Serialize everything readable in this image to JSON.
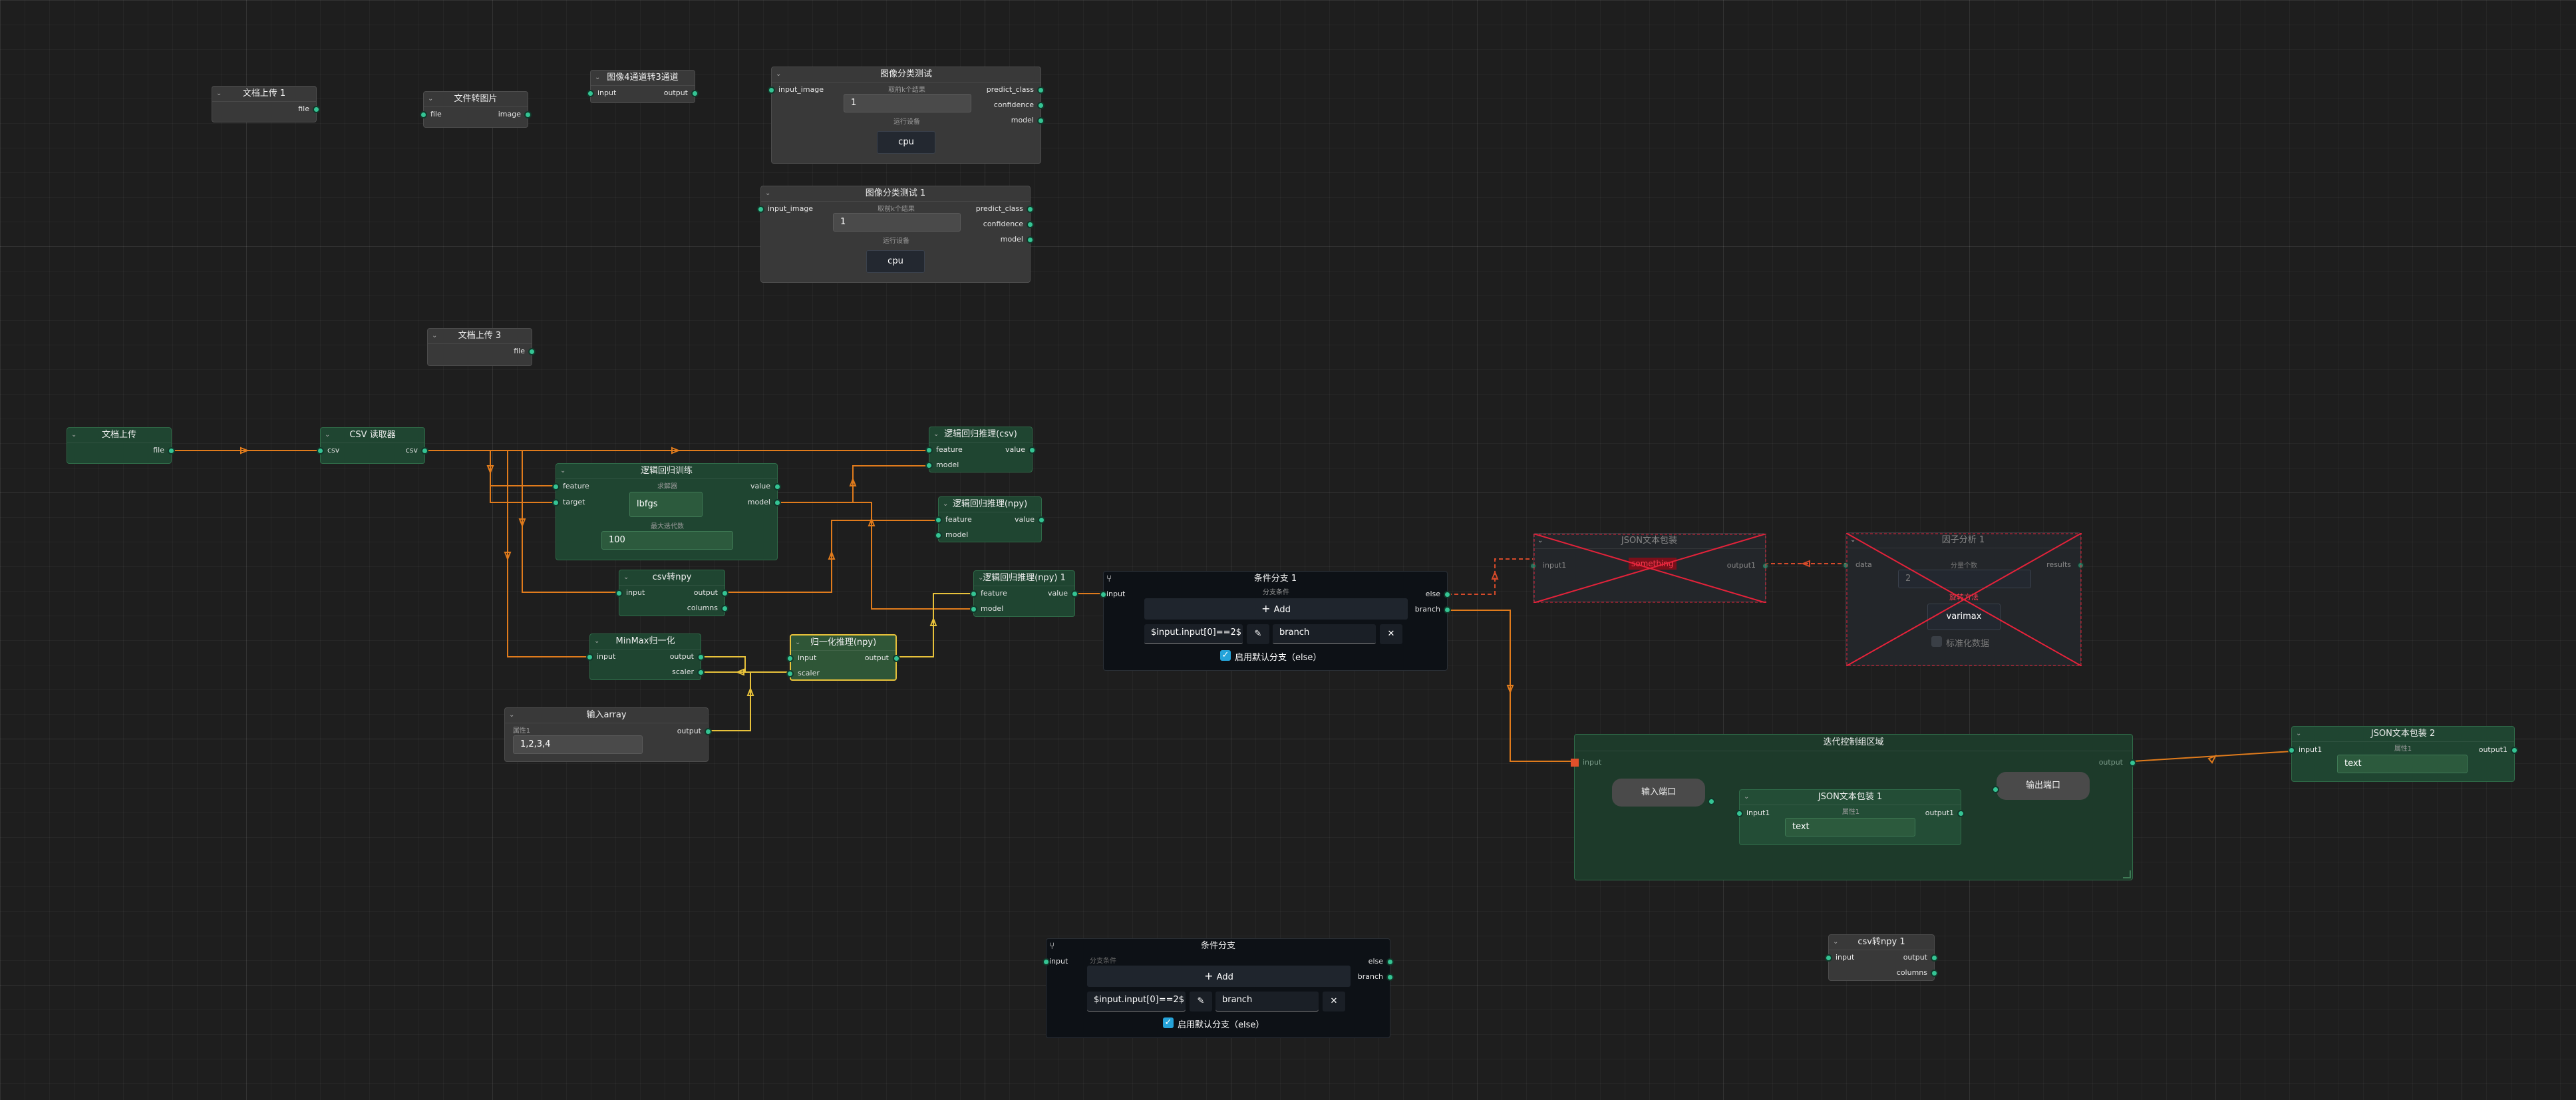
{
  "colors": {
    "canvas": "#1e1e1e",
    "port": "#35c494",
    "edge": "#e07b1c",
    "edge_yellow": "#e8c23b",
    "error": "#e6223a",
    "checkbox": "#25a3d9"
  },
  "icons": {
    "collapse": "chevron-down-icon",
    "branch": "branch-icon",
    "edit": "pencil-icon",
    "close": "x-icon",
    "check": "check-icon",
    "add": "plus-icon"
  },
  "nodes": {
    "upload1": {
      "title": "文档上传 1",
      "out": "file"
    },
    "readimg": {
      "title": "文件转图片",
      "in": "file",
      "out": "image"
    },
    "rgb": {
      "title": "图像4通道转3通道",
      "in": "input",
      "out": "output"
    },
    "cls": {
      "title": "图像分类测试",
      "in": "input_image",
      "out1": "predict_class",
      "out2": "confidence",
      "out3": "model",
      "label1": "取前k个结果",
      "value1": "1",
      "label2": "运行设备",
      "value2": "cpu"
    },
    "cls1": {
      "title": "图像分类测试 1",
      "in": "input_image",
      "out1": "predict_class",
      "out2": "confidence",
      "out3": "model",
      "label1": "取前k个结果",
      "value1": "1",
      "label2": "运行设备",
      "value2": "cpu"
    },
    "upload3": {
      "title": "文档上传 3",
      "out": "file"
    },
    "upload": {
      "title": "文档上传",
      "out": "file"
    },
    "csv": {
      "title": "CSV 读取器",
      "in": "csv",
      "out": "csv"
    },
    "lrtrain": {
      "title": "逻辑回归训练",
      "in1": "feature",
      "in2": "target",
      "out1": "value",
      "out2": "model",
      "label1": "求解器",
      "value1": "lbfgs",
      "label2": "最大迭代数",
      "value2": "100"
    },
    "lrcsv": {
      "title": "逻辑回归推理(csv)",
      "in1": "feature",
      "in2": "model",
      "out": "value"
    },
    "lrnpy": {
      "title": "逻辑回归推理(npy)",
      "in1": "feature",
      "in2": "model",
      "out": "value"
    },
    "csv2npy": {
      "title": "csv转npy",
      "in": "input",
      "out1": "output",
      "out2": "columns"
    },
    "lrnpy1": {
      "title": "逻辑回归推理(npy) 1",
      "in1": "feature",
      "in2": "model",
      "out": "value"
    },
    "minmax": {
      "title": "MinMax归一化",
      "in": "input",
      "out1": "output",
      "out2": "scaler"
    },
    "norminf": {
      "title": "归一化推理(npy)",
      "in1": "input",
      "in2": "scaler",
      "out": "output"
    },
    "arr": {
      "title": "输入array",
      "out": "output",
      "label": "属性1",
      "value": "1,2,3,4"
    },
    "cond1": {
      "title": "条件分支 1",
      "in": "input",
      "out1": "else",
      "out2": "branch",
      "sublabel": "分支条件",
      "add": "Add",
      "expr": "$input.input[0]==2$",
      "branch": "branch",
      "check": "启用默认分支（else）"
    },
    "json": {
      "title": "JSON文本包装",
      "in": "input1",
      "out": "output1",
      "err": "something"
    },
    "factor": {
      "title": "因子分析 1",
      "in": "data",
      "out": "results",
      "label1": "分量个数",
      "value1": "2",
      "label2": "旋转方法",
      "value2": "varimax",
      "check": "标准化数据"
    },
    "loop": {
      "title": "迭代控制组区域",
      "in": "input",
      "out": "output",
      "pin": "输入端口",
      "pout": "输出端口"
    },
    "json1": {
      "title": "JSON文本包装 1",
      "in": "input1",
      "out": "output1",
      "label": "属性1",
      "value": "text"
    },
    "json2": {
      "title": "JSON文本包装 2",
      "in": "input1",
      "out": "output1",
      "label": "属性1",
      "value": "text"
    },
    "cond": {
      "title": "条件分支",
      "in": "input",
      "out1": "else",
      "out2": "branch",
      "sublabel": "分支条件",
      "add": "Add",
      "expr": "$input.input[0]==2$",
      "branch": "branch",
      "check": "启用默认分支（else）"
    },
    "csv2npy1": {
      "title": "csv转npy 1",
      "in": "input",
      "out1": "output",
      "out2": "columns"
    }
  }
}
